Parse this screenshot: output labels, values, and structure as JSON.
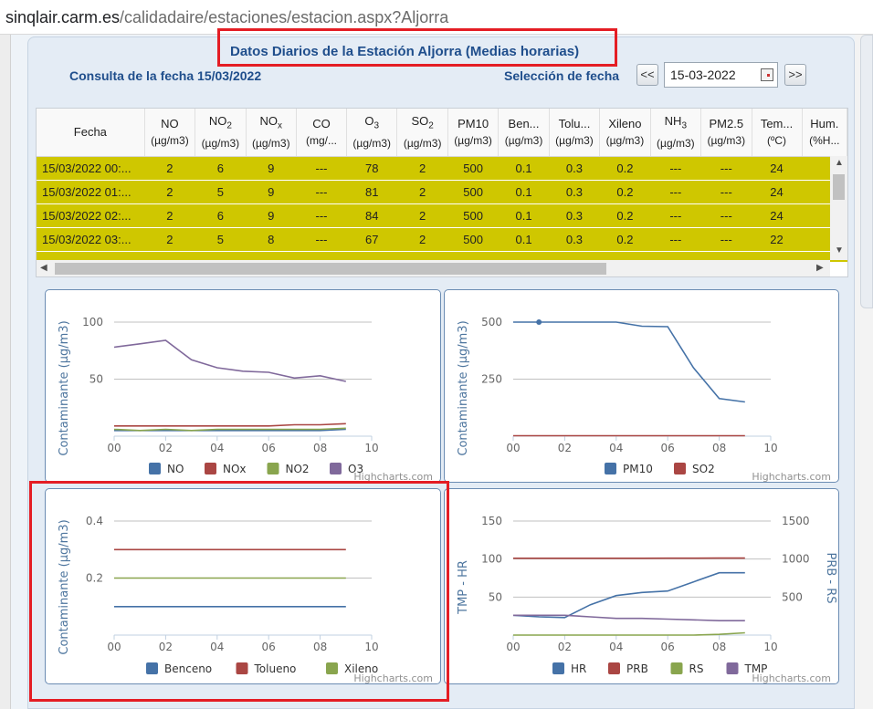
{
  "browser": {
    "url_host": "sinqlair.carm.es",
    "url_path": "/calidadaire/estaciones/estacion.aspx?Aljorra"
  },
  "page": {
    "title": "Datos Diarios de la Estación Aljorra (Medias horarias)",
    "subtitle": "Consulta de la fecha 15/03/2022",
    "date_selector_label": "Selección de fecha",
    "prev_label": "<<",
    "next_label": ">>",
    "date_value": "15-03-2022"
  },
  "table": {
    "columns": [
      {
        "name": "Fecha",
        "unit": ""
      },
      {
        "name": "NO",
        "unit": "(µg/m3)"
      },
      {
        "name": "NO2",
        "unit": "(µg/m3)"
      },
      {
        "name": "NOx",
        "unit": "(µg/m3)"
      },
      {
        "name": "CO",
        "unit": "(mg/..."
      },
      {
        "name": "O3",
        "unit": "(µg/m3)"
      },
      {
        "name": "SO2",
        "unit": "(µg/m3)"
      },
      {
        "name": "PM10",
        "unit": "(µg/m3)"
      },
      {
        "name": "Ben...",
        "unit": "(µg/m3)"
      },
      {
        "name": "Tolu...",
        "unit": "(µg/m3)"
      },
      {
        "name": "Xileno",
        "unit": "(µg/m3)"
      },
      {
        "name": "NH3",
        "unit": "(µg/m3)"
      },
      {
        "name": "PM2.5",
        "unit": "(µg/m3)"
      },
      {
        "name": "Tem...",
        "unit": "(ºC)"
      },
      {
        "name": "Hum.",
        "unit": "(%H..."
      }
    ],
    "rows": [
      [
        "15/03/2022 00:...",
        "2",
        "6",
        "9",
        "---",
        "78",
        "2",
        "500",
        "0.1",
        "0.3",
        "0.2",
        "---",
        "---",
        "24",
        ""
      ],
      [
        "15/03/2022 01:...",
        "2",
        "5",
        "9",
        "---",
        "81",
        "2",
        "500",
        "0.1",
        "0.3",
        "0.2",
        "---",
        "---",
        "24",
        ""
      ],
      [
        "15/03/2022 02:...",
        "2",
        "6",
        "9",
        "---",
        "84",
        "2",
        "500",
        "0.1",
        "0.3",
        "0.2",
        "---",
        "---",
        "24",
        ""
      ],
      [
        "15/03/2022 03:...",
        "2",
        "5",
        "8",
        "---",
        "67",
        "2",
        "500",
        "0.1",
        "0.3",
        "0.2",
        "---",
        "---",
        "22",
        ""
      ]
    ]
  },
  "credits": "Highcharts.com",
  "chart_data": [
    {
      "type": "line",
      "ylabel": "Contaminante (µg/m3)",
      "ylim": [
        0,
        100
      ],
      "yticks": [
        50,
        100
      ],
      "xticks": [
        "00",
        "02",
        "04",
        "06",
        "08",
        "10"
      ],
      "xlim": [
        0,
        10
      ],
      "grid": true,
      "legend_position": "bottom",
      "series": [
        {
          "name": "NO",
          "color": "#4572a7",
          "x": [
            0,
            1,
            2,
            3,
            4,
            5,
            6,
            7,
            8,
            9
          ],
          "values": [
            5,
            5,
            5,
            5,
            5,
            5,
            5,
            5,
            5,
            6
          ]
        },
        {
          "name": "NOx",
          "color": "#aa4643",
          "x": [
            0,
            1,
            2,
            3,
            4,
            5,
            6,
            7,
            8,
            9
          ],
          "values": [
            9,
            9,
            9,
            9,
            9,
            9,
            9,
            10,
            10,
            11
          ]
        },
        {
          "name": "NO2",
          "color": "#89a54e",
          "x": [
            0,
            1,
            2,
            3,
            4,
            5,
            6,
            7,
            8,
            9
          ],
          "values": [
            6,
            5,
            6,
            5,
            6,
            6,
            6,
            6,
            6,
            7
          ]
        },
        {
          "name": "O3",
          "color": "#80699b",
          "x": [
            0,
            1,
            2,
            3,
            4,
            5,
            6,
            7,
            8,
            9
          ],
          "values": [
            78,
            81,
            84,
            67,
            60,
            57,
            56,
            51,
            53,
            48
          ]
        }
      ]
    },
    {
      "type": "line",
      "ylabel": "Contaminante (µg/m3)",
      "ylim": [
        0,
        500
      ],
      "yticks": [
        250,
        500
      ],
      "xticks": [
        "00",
        "02",
        "04",
        "06",
        "08",
        "10"
      ],
      "xlim": [
        0,
        10
      ],
      "grid": true,
      "legend_position": "bottom",
      "series": [
        {
          "name": "PM10",
          "color": "#4572a7",
          "x": [
            0,
            1,
            2,
            3,
            4,
            5,
            6,
            7,
            8,
            9
          ],
          "values": [
            500,
            500,
            500,
            500,
            500,
            482,
            480,
            300,
            165,
            150
          ]
        },
        {
          "name": "SO2",
          "color": "#aa4643",
          "x": [
            0,
            1,
            2,
            3,
            4,
            5,
            6,
            7,
            8,
            9
          ],
          "values": [
            2,
            2,
            2,
            2,
            2,
            2,
            2,
            2,
            2,
            2
          ]
        }
      ]
    },
    {
      "type": "line",
      "ylabel": "Contaminante (µg/m3)",
      "ylim": [
        0,
        0.4
      ],
      "yticks": [
        0.2,
        0.4
      ],
      "xticks": [
        "00",
        "02",
        "04",
        "06",
        "08",
        "10"
      ],
      "xlim": [
        0,
        10
      ],
      "grid": true,
      "legend_position": "bottom",
      "series": [
        {
          "name": "Benceno",
          "color": "#4572a7",
          "x": [
            0,
            1,
            2,
            3,
            4,
            5,
            6,
            7,
            8,
            9
          ],
          "values": [
            0.1,
            0.1,
            0.1,
            0.1,
            0.1,
            0.1,
            0.1,
            0.1,
            0.1,
            0.1
          ]
        },
        {
          "name": "Tolueno",
          "color": "#aa4643",
          "x": [
            0,
            1,
            2,
            3,
            4,
            5,
            6,
            7,
            8,
            9
          ],
          "values": [
            0.3,
            0.3,
            0.3,
            0.3,
            0.3,
            0.3,
            0.3,
            0.3,
            0.3,
            0.3
          ]
        },
        {
          "name": "Xileno",
          "color": "#89a54e",
          "x": [
            0,
            1,
            2,
            3,
            4,
            5,
            6,
            7,
            8,
            9
          ],
          "values": [
            0.2,
            0.2,
            0.2,
            0.2,
            0.2,
            0.2,
            0.2,
            0.2,
            0.2,
            0.2
          ]
        }
      ]
    },
    {
      "type": "line",
      "ylabel": "TMP - HR",
      "ylabel_right": "PRB - RS",
      "ylim": [
        0,
        150
      ],
      "ylim_right": [
        0,
        1500
      ],
      "yticks": [
        50,
        100,
        150
      ],
      "yticks_right": [
        500,
        1000,
        1500
      ],
      "xticks": [
        "00",
        "02",
        "04",
        "06",
        "08",
        "10"
      ],
      "xlim": [
        0,
        10
      ],
      "grid": true,
      "legend_position": "bottom",
      "series": [
        {
          "name": "HR",
          "color": "#4572a7",
          "axis": "left",
          "x": [
            0,
            1,
            2,
            3,
            4,
            5,
            6,
            7,
            8,
            9
          ],
          "values": [
            26,
            24,
            23,
            40,
            52,
            56,
            58,
            70,
            82,
            82
          ]
        },
        {
          "name": "PRB",
          "color": "#aa4643",
          "axis": "right",
          "x": [
            0,
            1,
            2,
            3,
            4,
            5,
            6,
            7,
            8,
            9
          ],
          "values": [
            1010,
            1010,
            1010,
            1010,
            1011,
            1011,
            1012,
            1012,
            1013,
            1013
          ]
        },
        {
          "name": "RS",
          "color": "#89a54e",
          "axis": "right",
          "x": [
            0,
            1,
            2,
            3,
            4,
            5,
            6,
            7,
            8,
            9
          ],
          "values": [
            0,
            0,
            0,
            0,
            0,
            0,
            0,
            0,
            10,
            30
          ]
        },
        {
          "name": "TMP",
          "color": "#80699b",
          "axis": "left",
          "x": [
            0,
            1,
            2,
            3,
            4,
            5,
            6,
            7,
            8,
            9
          ],
          "values": [
            26,
            26,
            26,
            24,
            22,
            22,
            21,
            20,
            19,
            19
          ]
        }
      ]
    }
  ]
}
